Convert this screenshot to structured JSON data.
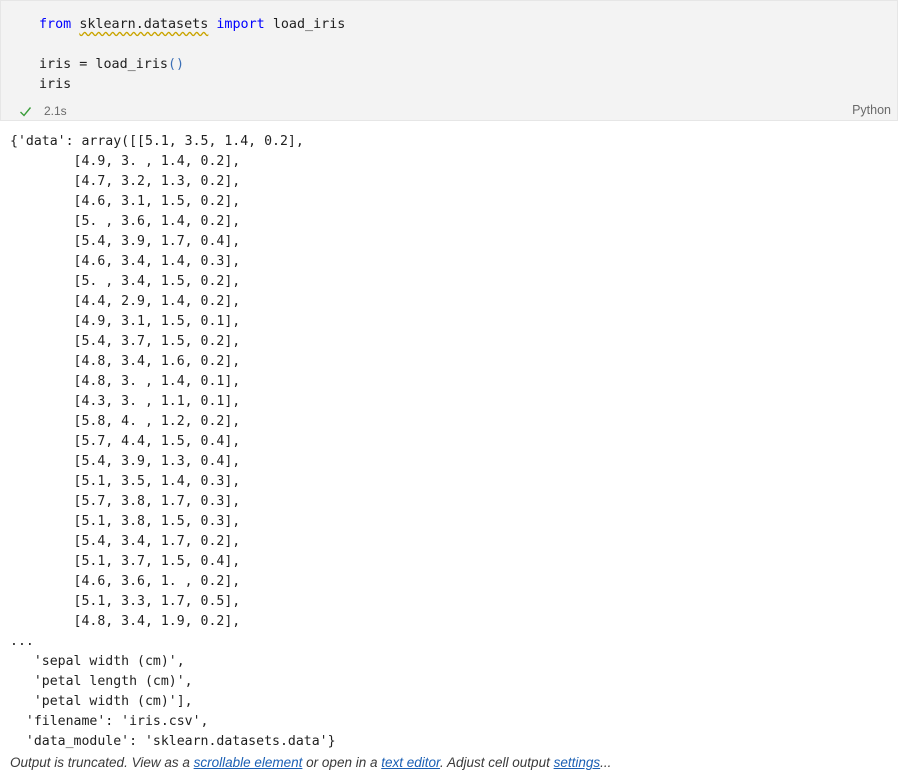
{
  "cell": {
    "code": {
      "kw_from": "from",
      "module": "sklearn.datasets",
      "kw_import": "import",
      "name": "load_iris",
      "assign_lhs": "iris = load_iris",
      "parens": "()",
      "last_line": "iris"
    },
    "status_time": "2.1s",
    "status_icon": "check-icon",
    "language": "Python"
  },
  "output": {
    "lines": [
      "{'data': array([[5.1, 3.5, 1.4, 0.2],",
      "        [4.9, 3. , 1.4, 0.2],",
      "        [4.7, 3.2, 1.3, 0.2],",
      "        [4.6, 3.1, 1.5, 0.2],",
      "        [5. , 3.6, 1.4, 0.2],",
      "        [5.4, 3.9, 1.7, 0.4],",
      "        [4.6, 3.4, 1.4, 0.3],",
      "        [5. , 3.4, 1.5, 0.2],",
      "        [4.4, 2.9, 1.4, 0.2],",
      "        [4.9, 3.1, 1.5, 0.1],",
      "        [5.4, 3.7, 1.5, 0.2],",
      "        [4.8, 3.4, 1.6, 0.2],",
      "        [4.8, 3. , 1.4, 0.1],",
      "        [4.3, 3. , 1.1, 0.1],",
      "        [5.8, 4. , 1.2, 0.2],",
      "        [5.7, 4.4, 1.5, 0.4],",
      "        [5.4, 3.9, 1.3, 0.4],",
      "        [5.1, 3.5, 1.4, 0.3],",
      "        [5.7, 3.8, 1.7, 0.3],",
      "        [5.1, 3.8, 1.5, 0.3],",
      "        [5.4, 3.4, 1.7, 0.2],",
      "        [5.1, 3.7, 1.5, 0.4],",
      "        [4.6, 3.6, 1. , 0.2],",
      "        [5.1, 3.3, 1.7, 0.5],",
      "        [4.8, 3.4, 1.9, 0.2],",
      "...",
      "   'sepal width (cm)',",
      "   'petal length (cm)',",
      "   'petal width (cm)'],",
      "  'filename': 'iris.csv',",
      "  'data_module': 'sklearn.datasets.data'}"
    ]
  },
  "truncation": {
    "prefix": "Output is truncated. View as a ",
    "link1": "scrollable element",
    "middle": " or open in a ",
    "link2": "text editor",
    "after": ". Adjust cell output ",
    "link3": "settings",
    "suffix": "..."
  }
}
